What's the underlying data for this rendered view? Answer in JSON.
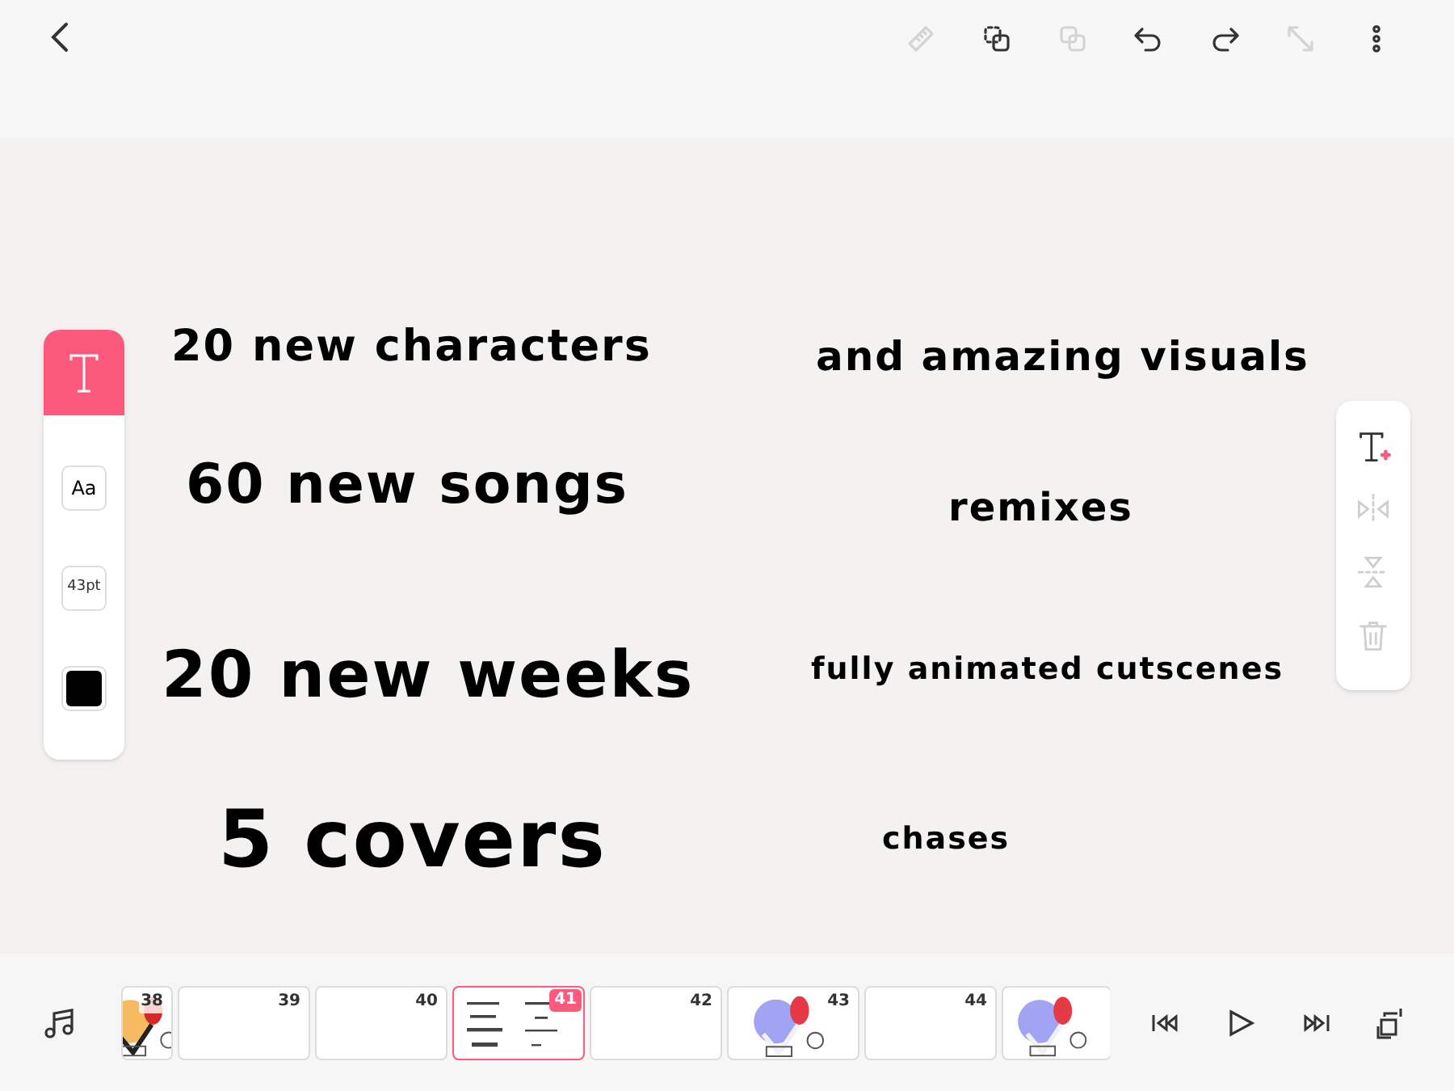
{
  "toolbar": [
    {
      "kind": "ruler",
      "disabled": true
    },
    {
      "kind": "duplicate",
      "disabled": false
    },
    {
      "kind": "copy",
      "disabled": true
    },
    {
      "kind": "undo",
      "disabled": false
    },
    {
      "kind": "redo",
      "disabled": false
    },
    {
      "kind": "resize",
      "disabled": true
    },
    {
      "kind": "more",
      "disabled": false
    }
  ],
  "text_panel": {
    "tool_selected": true,
    "font": "Aa",
    "size": "43pt",
    "color": "#000000"
  },
  "canvas_texts": [
    "20 new characters",
    "and amazing visuals",
    "60 new songs",
    "remixes",
    "20 new weeks",
    "fully animated cutscenes",
    "5 covers",
    "chases"
  ],
  "edit_panel": [
    {
      "kind": "add-text",
      "disabled": false
    },
    {
      "kind": "flip-horizontal",
      "disabled": true
    },
    {
      "kind": "flip-vertical",
      "disabled": true
    },
    {
      "kind": "delete",
      "disabled": true
    }
  ],
  "frames": [
    {
      "number": "38",
      "kind": "picture",
      "selected": false
    },
    {
      "number": "39",
      "kind": "blank",
      "selected": false
    },
    {
      "number": "40",
      "kind": "blank",
      "selected": false
    },
    {
      "number": "41",
      "kind": "text",
      "selected": true
    },
    {
      "number": "42",
      "kind": "blank",
      "selected": false
    },
    {
      "number": "43",
      "kind": "picture",
      "selected": false
    },
    {
      "number": "44",
      "kind": "blank",
      "selected": false
    },
    {
      "kind": "picture",
      "selected": false
    }
  ]
}
